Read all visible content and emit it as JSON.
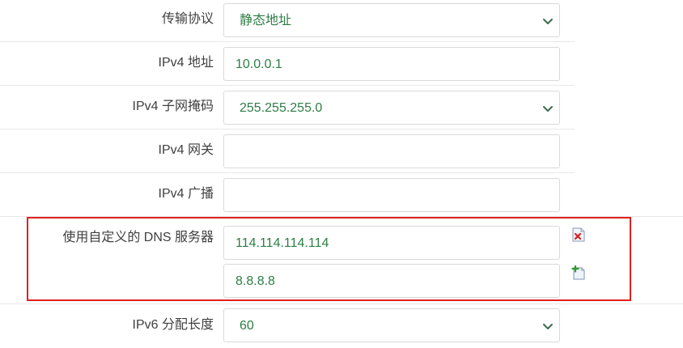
{
  "fields": {
    "protocol": {
      "label": "传输协议",
      "value": "静态地址"
    },
    "ipv4_addr": {
      "label": "IPv4 地址",
      "value": "10.0.0.1"
    },
    "ipv4_mask": {
      "label": "IPv4 子网掩码",
      "value": "255.255.255.0"
    },
    "ipv4_gateway": {
      "label": "IPv4 网关",
      "value": ""
    },
    "ipv4_broadcast": {
      "label": "IPv4 广播",
      "value": ""
    },
    "dns": {
      "label": "使用自定义的 DNS 服务器",
      "servers": [
        "114.114.114.114",
        "8.8.8.8"
      ]
    },
    "ipv6_prefix": {
      "label": "IPv6 分配长度",
      "value": "60"
    }
  },
  "colors": {
    "value_text": "#2e7d46",
    "highlight_border": "#e02020",
    "chevron": "#3a6b4e"
  },
  "icons": {
    "remove": "remove-dns-icon",
    "add": "add-dns-icon"
  }
}
